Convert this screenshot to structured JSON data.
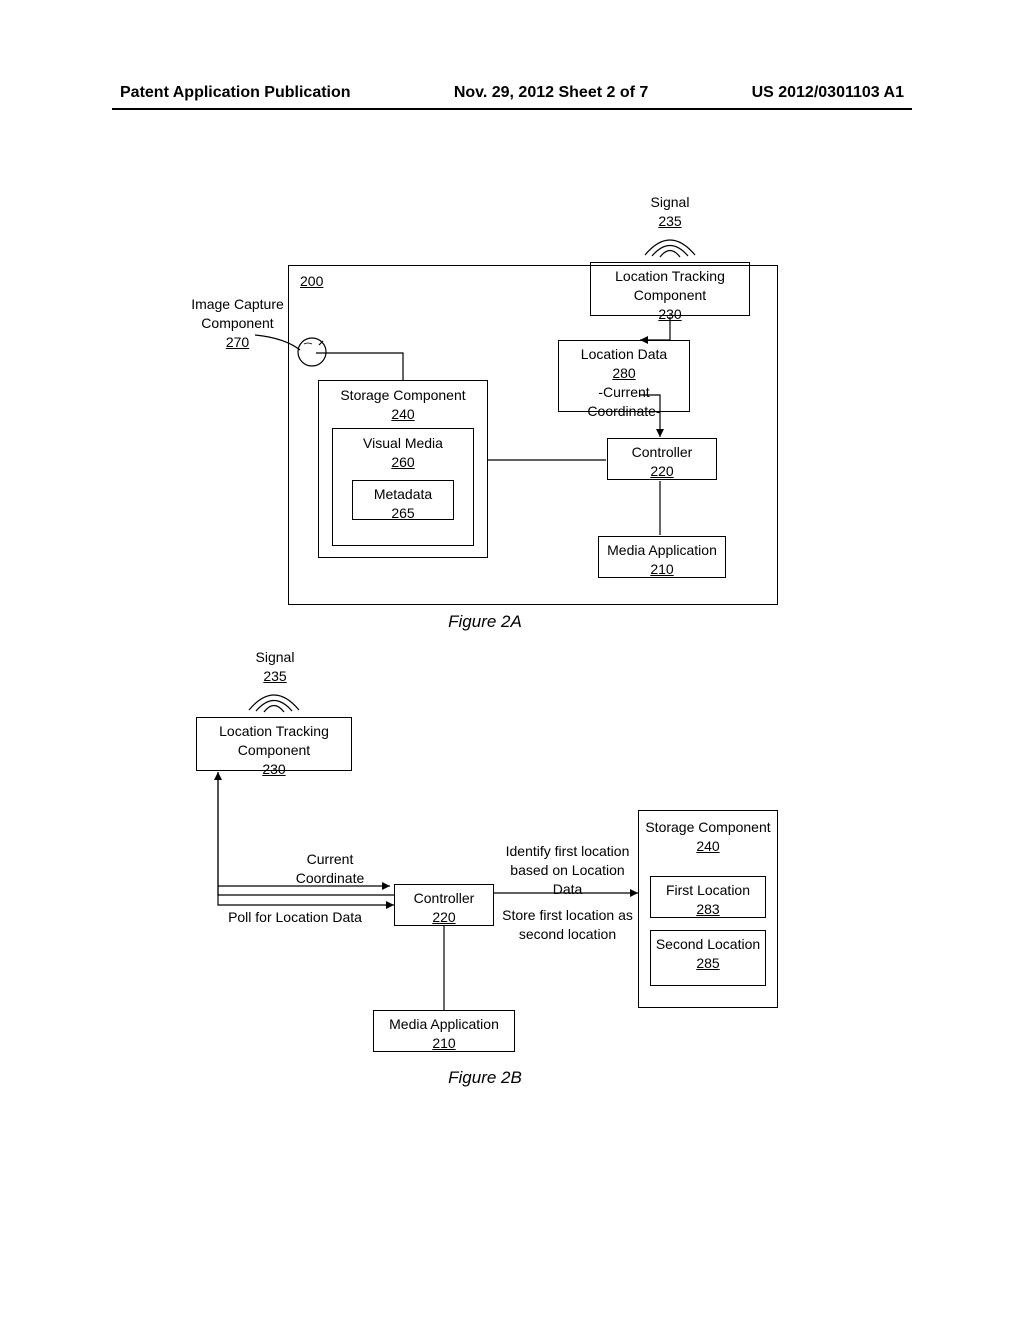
{
  "header": {
    "left": "Patent Application Publication",
    "center": "Nov. 29, 2012  Sheet 2 of 7",
    "right": "US 2012/0301103 A1"
  },
  "figA": {
    "caption": "Figure 2A",
    "signal": "Signal",
    "signal_n": "235",
    "tracking": "Location Tracking Component",
    "tracking_n": "230",
    "locdata": "Location Data",
    "locdata_n": "280",
    "locdata_sub": "-Current Coordinate-",
    "controller": "Controller",
    "controller_n": "220",
    "mediaapp": "Media Application",
    "mediaapp_n": "210",
    "storage": "Storage Component",
    "storage_n": "240",
    "visual": "Visual Media",
    "visual_n": "260",
    "metadata": "Metadata",
    "metadata_n": "265",
    "device_n": "200",
    "capture": "Image Capture Component",
    "capture_n": "270"
  },
  "figB": {
    "caption": "Figure 2B",
    "signal": "Signal",
    "signal_n": "235",
    "tracking": "Location Tracking Component",
    "tracking_n": "230",
    "controller": "Controller",
    "controller_n": "220",
    "mediaapp": "Media Application",
    "mediaapp_n": "210",
    "storage": "Storage Component",
    "storage_n": "240",
    "firstloc": "First Location",
    "firstloc_n": "283",
    "secondloc": "Second Location",
    "secondloc_n": "285",
    "coord": "Current Coordinate",
    "poll": "Poll for Location Data",
    "identify": "Identify first location based on Location Data",
    "store": "Store first location as second location"
  }
}
